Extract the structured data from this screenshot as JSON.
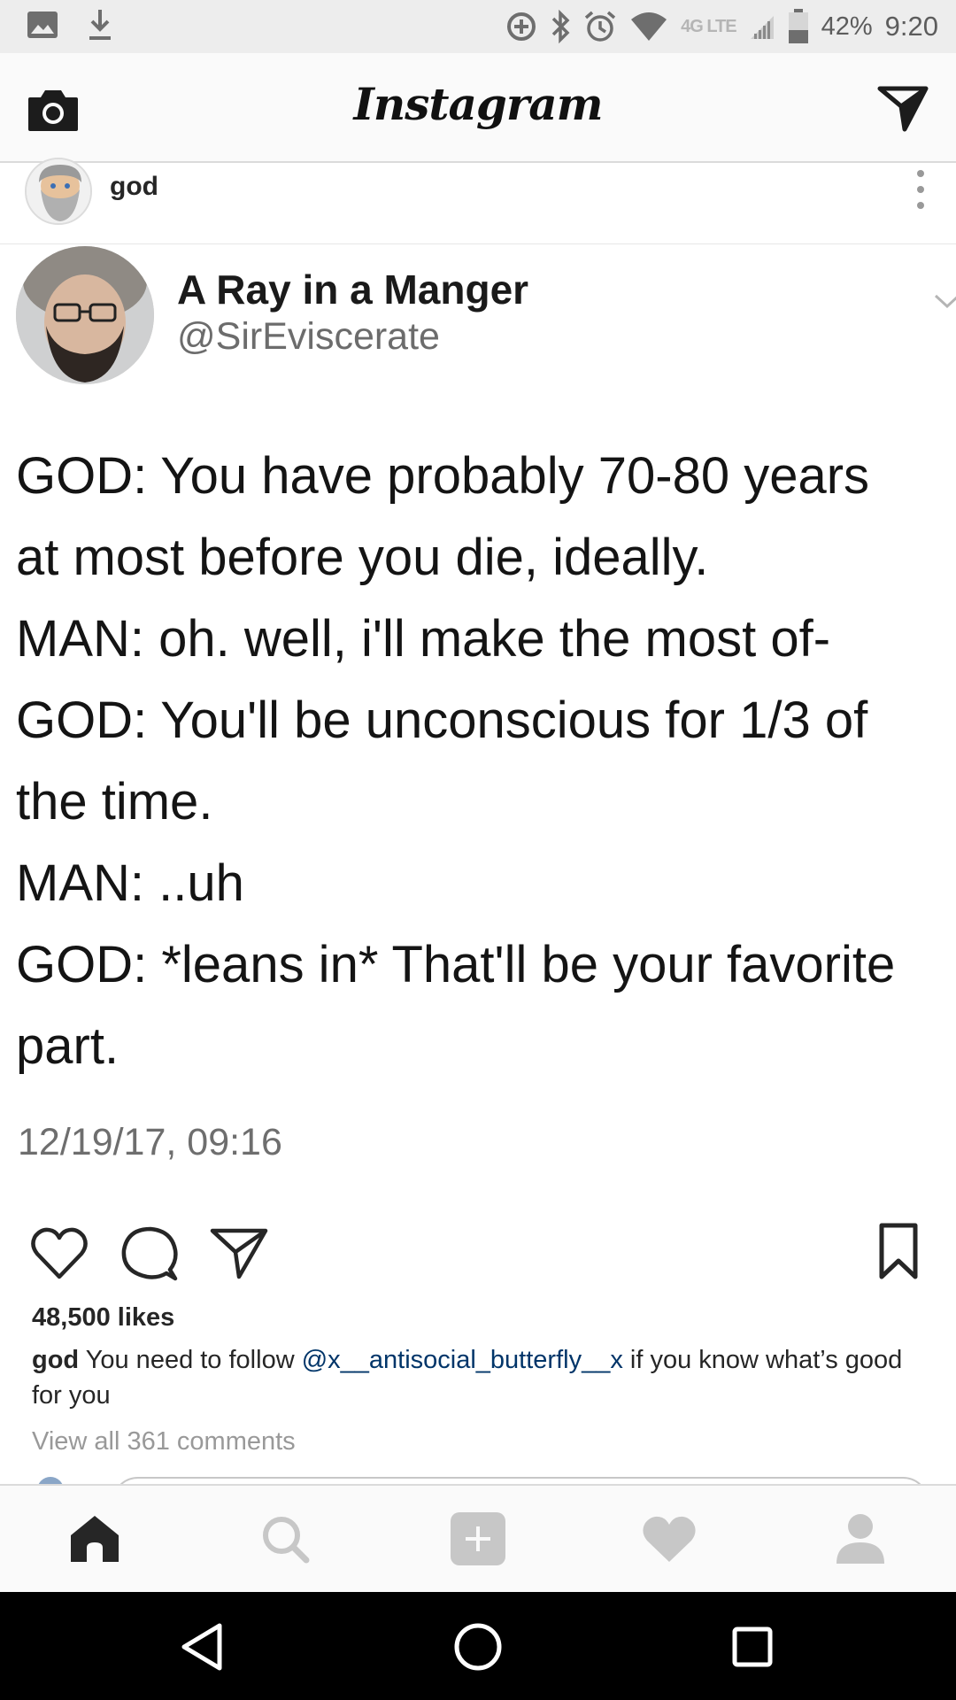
{
  "status_bar": {
    "network_label": "4G LTE",
    "battery_percent": "42%",
    "time": "9:20",
    "icons": [
      "gallery-icon",
      "download-icon",
      "data-saver-icon",
      "bluetooth-icon",
      "alarm-icon",
      "wifi-icon",
      "signal-icon",
      "battery-icon"
    ]
  },
  "app_header": {
    "title": "Instagram",
    "left_icon": "camera-icon",
    "right_icon": "direct-message-icon"
  },
  "post": {
    "username": "god",
    "more_icon": "more-vertical-icon",
    "tweet": {
      "display_name": "A Ray in a Manger",
      "handle": "@SirEviscerate",
      "lines": [
        "GOD: You have probably 70-80 years",
        "at most before you die, ideally.",
        "MAN: oh. well, i'll make the most of-",
        "GOD: You'll be unconscious for 1/3 of",
        "the time.",
        "MAN: ..uh",
        "GOD: *leans in* That'll be your favorite",
        "part."
      ],
      "timestamp": "12/19/17, 09:16"
    },
    "likes": "48,500 likes",
    "caption": {
      "user": "god",
      "text_before": " You need to follow ",
      "mention": "@x__antisocial_butterfly__x",
      "text_after": " if you know what’s good for you"
    },
    "view_comments": "View all 361 comments"
  },
  "bottom_nav": {
    "items": [
      "home-icon",
      "search-icon",
      "add-post-icon",
      "activity-heart-icon",
      "profile-icon"
    ],
    "active": "home-icon"
  },
  "system_nav": {
    "items": [
      "back-icon",
      "home-circle-icon",
      "recents-icon"
    ]
  }
}
